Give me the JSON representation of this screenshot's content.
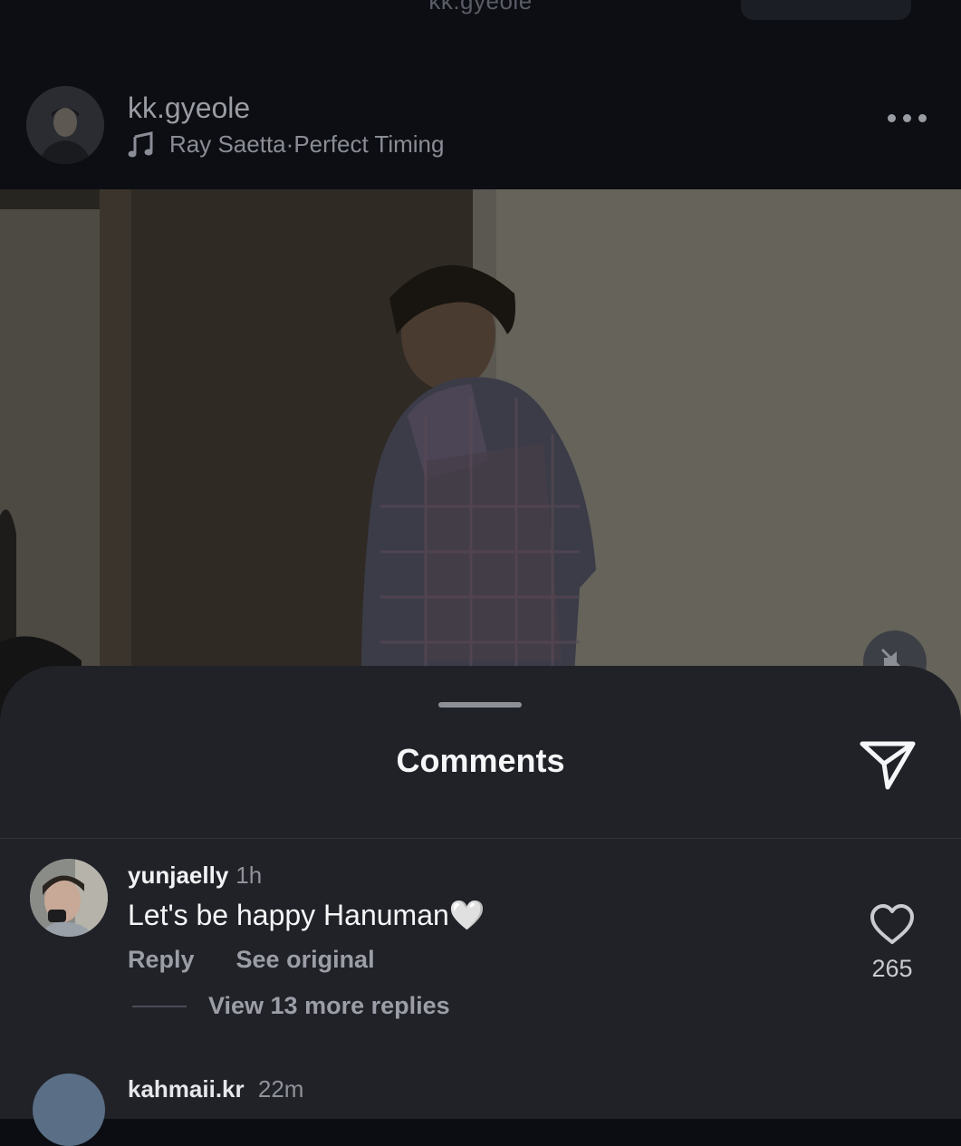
{
  "top_bar": {
    "handle": "kk.gyeole"
  },
  "post": {
    "username": "kk.gyeole",
    "music_artist": "Ray Saetta",
    "music_separator": " · ",
    "music_title": "Perfect Timing",
    "more_icon": "more-horizontal-icon",
    "mute_icon": "speaker-muted-icon"
  },
  "comments_sheet": {
    "title": "Comments",
    "share_icon": "send-icon",
    "comments": [
      {
        "username": "yunjaelly",
        "time": "1h",
        "text": "Let's be happy Hanuman🤍",
        "reply_label": "Reply",
        "see_original_label": "See original",
        "view_replies_label": "View 13 more replies",
        "like_count": "265"
      },
      {
        "username": "kahmaii.kr",
        "time": "22m"
      }
    ]
  },
  "colors": {
    "background": "#0b0d12",
    "sheet": "#202228",
    "text_primary": "#f5f6f8",
    "text_secondary": "#9b9ea6"
  }
}
